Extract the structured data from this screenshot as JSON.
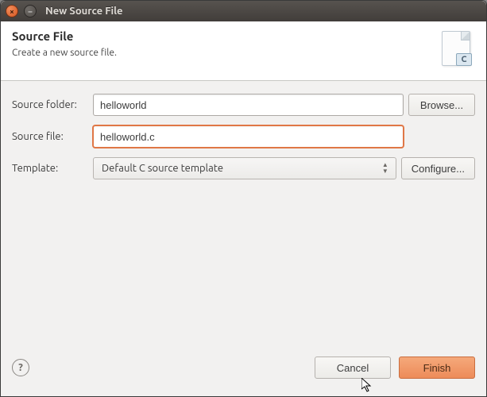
{
  "window": {
    "title": "New Source File"
  },
  "header": {
    "title": "Source File",
    "subtitle": "Create a new source file.",
    "badge": "C"
  },
  "form": {
    "source_folder_label": "Source folder:",
    "source_folder_value": "helloworld",
    "source_file_label": "Source file:",
    "source_file_value": "helloworld.c",
    "template_label": "Template:",
    "template_value": "Default C source template"
  },
  "buttons": {
    "browse": "Browse...",
    "configure": "Configure...",
    "cancel": "Cancel",
    "finish": "Finish"
  }
}
